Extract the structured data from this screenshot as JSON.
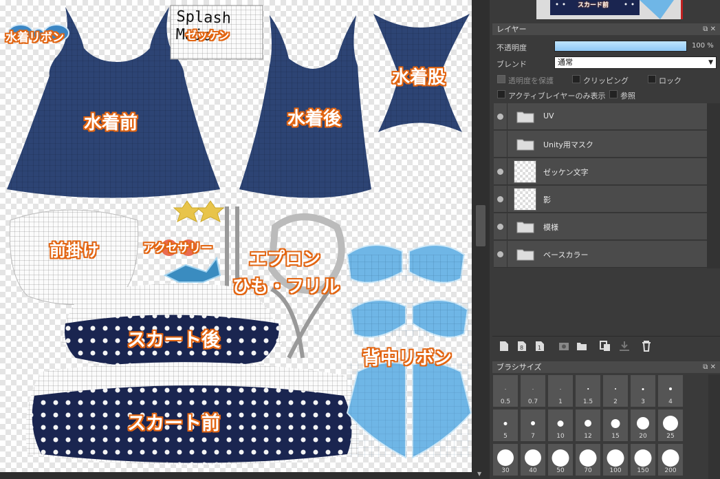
{
  "canvas": {
    "labels": {
      "ribbon": "水着リボン",
      "zekken": "ゼッケン",
      "zekken_text": "Splash\nMaid",
      "swim_front": "水着前",
      "swim_back": "水着後",
      "swim_crotch": "水着股",
      "apron_front": "前掛け",
      "accessory": "アクセサリー",
      "apron_string_1": "エプロン",
      "apron_string_2": "ひも・フリル",
      "skirt_back": "スカート後",
      "skirt_front": "スカート前",
      "back_ribbon": "背中リボン"
    },
    "nav_thumb_label": "スカード前"
  },
  "layer_panel": {
    "title": "レイヤー",
    "opacity_label": "不透明度",
    "opacity_value": "100 %",
    "opacity_level": 1.0,
    "blend_label": "ブレンド",
    "blend_value": "通常",
    "options": {
      "protect_alpha": "透明度を保護",
      "clipping": "クリッピング",
      "lock": "ロック",
      "active_only": "アクティブレイヤーのみ表示",
      "reference": "参照"
    },
    "layers": [
      {
        "name": "UV",
        "kind": "folder",
        "visible": true
      },
      {
        "name": "Unity用マスク",
        "kind": "folder",
        "visible": false
      },
      {
        "name": "ゼッケン文字",
        "kind": "layer",
        "visible": true
      },
      {
        "name": "影",
        "kind": "layer",
        "visible": true
      },
      {
        "name": "模様",
        "kind": "folder",
        "visible": true
      },
      {
        "name": "ベースカラー",
        "kind": "folder",
        "visible": true
      }
    ]
  },
  "brush_panel": {
    "title": "ブラシサイズ",
    "sizes": [
      "0.5",
      "0.7",
      "1",
      "1.5",
      "2",
      "3",
      "4",
      "5",
      "7",
      "10",
      "12",
      "15",
      "20",
      "25",
      "30",
      "40",
      "50",
      "70",
      "100",
      "150",
      "200"
    ]
  },
  "colors": {
    "navy": "#2a3d66",
    "light_blue": "#6fb6e6",
    "label_orange": "#e26512",
    "panel_bg": "#3a3a3a"
  }
}
